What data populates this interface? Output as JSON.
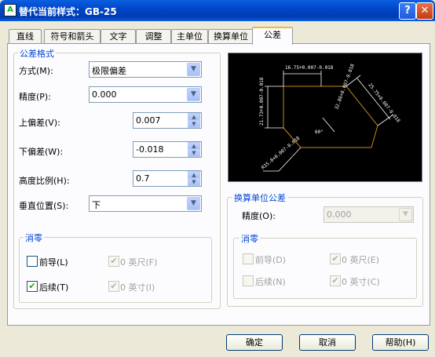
{
  "window": {
    "title": "替代当前样式：GB-25",
    "help_symbol": "?",
    "close_symbol": "✕",
    "app_icon": "A"
  },
  "tabs": [
    {
      "label": "直线"
    },
    {
      "label": "符号和箭头"
    },
    {
      "label": "文字"
    },
    {
      "label": "调整"
    },
    {
      "label": "主单位"
    },
    {
      "label": "换算单位"
    },
    {
      "label": "公差"
    }
  ],
  "tolerance_format": {
    "legend": "公差格式",
    "method": {
      "label": "方式(M):",
      "value": "极限偏差"
    },
    "precision": {
      "label": "精度(P):",
      "value": "0.000"
    },
    "upper": {
      "label": "上偏差(V):",
      "value": "0.007"
    },
    "lower": {
      "label": "下偏差(W):",
      "value": "-0.018"
    },
    "height_scale": {
      "label": "高度比例(H):",
      "value": "0.7"
    },
    "vertical_position": {
      "label": "垂直位置(S):",
      "value": "下"
    }
  },
  "zero_suppression": {
    "legend": "消零",
    "leading": {
      "label": "前导(L)",
      "checked": false
    },
    "trailing": {
      "label": "后续(T)",
      "checked": true
    },
    "feet": {
      "label": "0 英尺(F)",
      "checked": true
    },
    "inches": {
      "label": "0 英寸(I)",
      "checked": true
    }
  },
  "preview": {
    "labels": [
      "16.75+0.007-0.018",
      "21.73+0.007-0.018",
      "25.75+0.007-0.018",
      "32.86+0.007-0.018",
      "60°",
      "R15.8+0.007-0.018"
    ]
  },
  "alt_unit_tolerance": {
    "legend": "换算单位公差",
    "precision": {
      "label": "精度(O):",
      "value": "0.000"
    },
    "zero": {
      "legend": "消零",
      "leading": {
        "label": "前导(D)"
      },
      "trailing": {
        "label": "后续(N)"
      },
      "feet": {
        "label": "0 英尺(E)"
      },
      "inches": {
        "label": "0 英寸(C)"
      }
    }
  },
  "buttons": {
    "ok": "确定",
    "cancel": "取消",
    "help": "帮助(H)"
  },
  "colors": {
    "titlebar": "#0047c9",
    "group_legend": "#0046d5",
    "preview_bg": "#000000",
    "preview_geometry": "#c8891a"
  }
}
